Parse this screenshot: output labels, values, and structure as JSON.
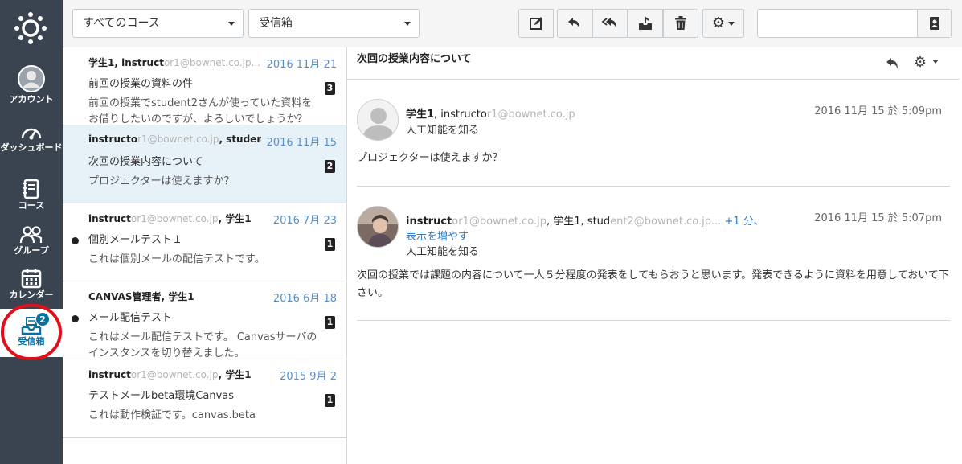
{
  "nav": {
    "account": "アカウント",
    "dashboard": "ダッシュボード",
    "courses": "コース",
    "groups": "グループ",
    "calendar": "カレンダー",
    "inbox": "受信箱",
    "inbox_badge": "2"
  },
  "toolbar": {
    "course_filter": "すべてのコース",
    "mailbox_filter": "受信箱",
    "search_placeholder": ""
  },
  "conversations": [
    {
      "from_bold": "学生1, instruct",
      "from_blur": "or1@bownet.co.jp...",
      "date": "2016 11月 21",
      "subject": "前回の授業の資料の件",
      "preview": "前回の授業でstudent2さんが使っていた資料をお借りしたいのですが、よろしいでしょうか？",
      "count": "3"
    },
    {
      "from_bold": "instructo",
      "from_blur": "r1@bownet.co.jp",
      "from_tail": ", studen...",
      "date": "2016 11月 15",
      "subject": "次回の授業内容について",
      "preview": "プロジェクターは使えますか？",
      "count": "2"
    },
    {
      "from_bold": "instruct",
      "from_blur": "or1@bownet.co.jp",
      "from_tail": ", 学生1",
      "date": "2016 7月 23",
      "subject": "個別メールテスト１",
      "preview": "これは個別メールの配信テストです。",
      "count": "1"
    },
    {
      "from_bold": "CANVAS管理者, 学生1",
      "date": "2016 6月 18",
      "subject": "メール配信テスト",
      "preview": "これはメール配信テストです。 Canvasサーバのインスタンスを切り替えました。",
      "count": "1"
    },
    {
      "from_bold": "instruct",
      "from_blur": "or1@bownet.co.jp",
      "from_tail": ", 学生1",
      "date": "2015 9月 2",
      "subject": "テストメールbeta環境Canvas",
      "preview": "これは動作検証です。canvas.beta",
      "count": "1"
    }
  ],
  "thread": {
    "title": "次回の授業内容について",
    "messages": [
      {
        "author": "学生1",
        "recipients_a": ", instructo",
        "recipients_blur": "r1@bownet.co.jp",
        "date": "2016 11月 15 於 5:09pm",
        "course": "人工知能を知る",
        "body": "プロジェクターは使えますか？"
      },
      {
        "author": "instruct",
        "recipients_blur": "or1@bownet.co.jp",
        "recipients_a": ", 学生1, stud",
        "recipients_blur2": "ent2@bownet.co.jp...",
        "more": " +1 分、",
        "show_more": "表示を増やす",
        "date": "2016 11月 15 於 5:07pm",
        "course": "人工知能を知る",
        "body": "次回の授業では課題の内容について一人５分程度の発表をしてもらおうと思います。発表できるように資料を用意しておいて下さい。"
      }
    ]
  }
}
